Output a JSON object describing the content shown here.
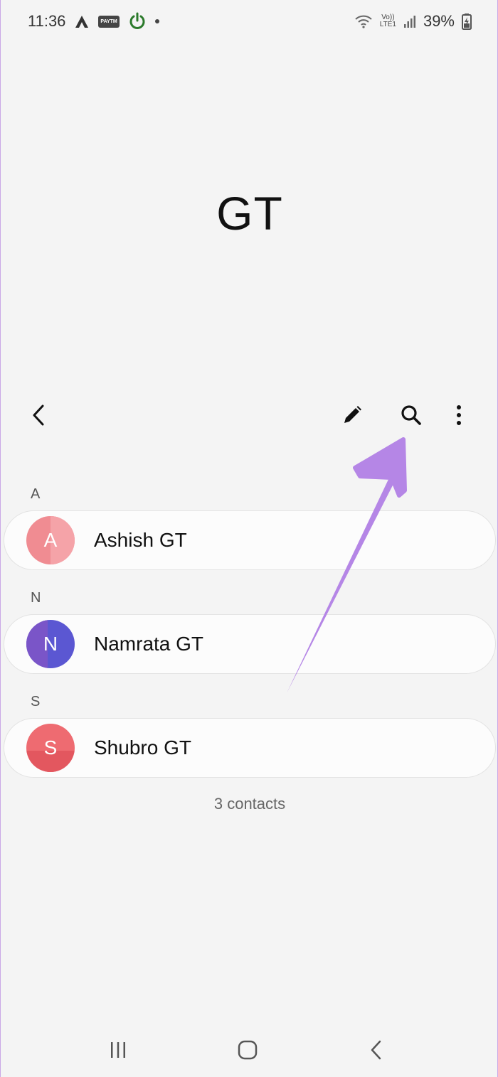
{
  "status_bar": {
    "time": "11:36",
    "paytm_label": "PAYTM",
    "volte_top": "Vo))",
    "volte_bottom": "LTE1",
    "battery_percent": "39%"
  },
  "page": {
    "title": "GT"
  },
  "icons": {
    "back": "chevron-left-icon",
    "edit": "pencil-icon",
    "search": "search-icon",
    "more": "more-vertical-icon"
  },
  "sections": [
    {
      "letter": "A",
      "contacts": [
        {
          "initial": "A",
          "name": "Ashish GT",
          "color": "#f08c92"
        }
      ]
    },
    {
      "letter": "N",
      "contacts": [
        {
          "initial": "N",
          "name": "Namrata GT",
          "color": "#5b57d2"
        }
      ]
    },
    {
      "letter": "S",
      "contacts": [
        {
          "initial": "S",
          "name": "Shubro GT",
          "color": "#ee6b71"
        }
      ]
    }
  ],
  "footer": {
    "contact_count": "3 contacts"
  },
  "annotation": {
    "arrow_color": "#b586e6"
  }
}
